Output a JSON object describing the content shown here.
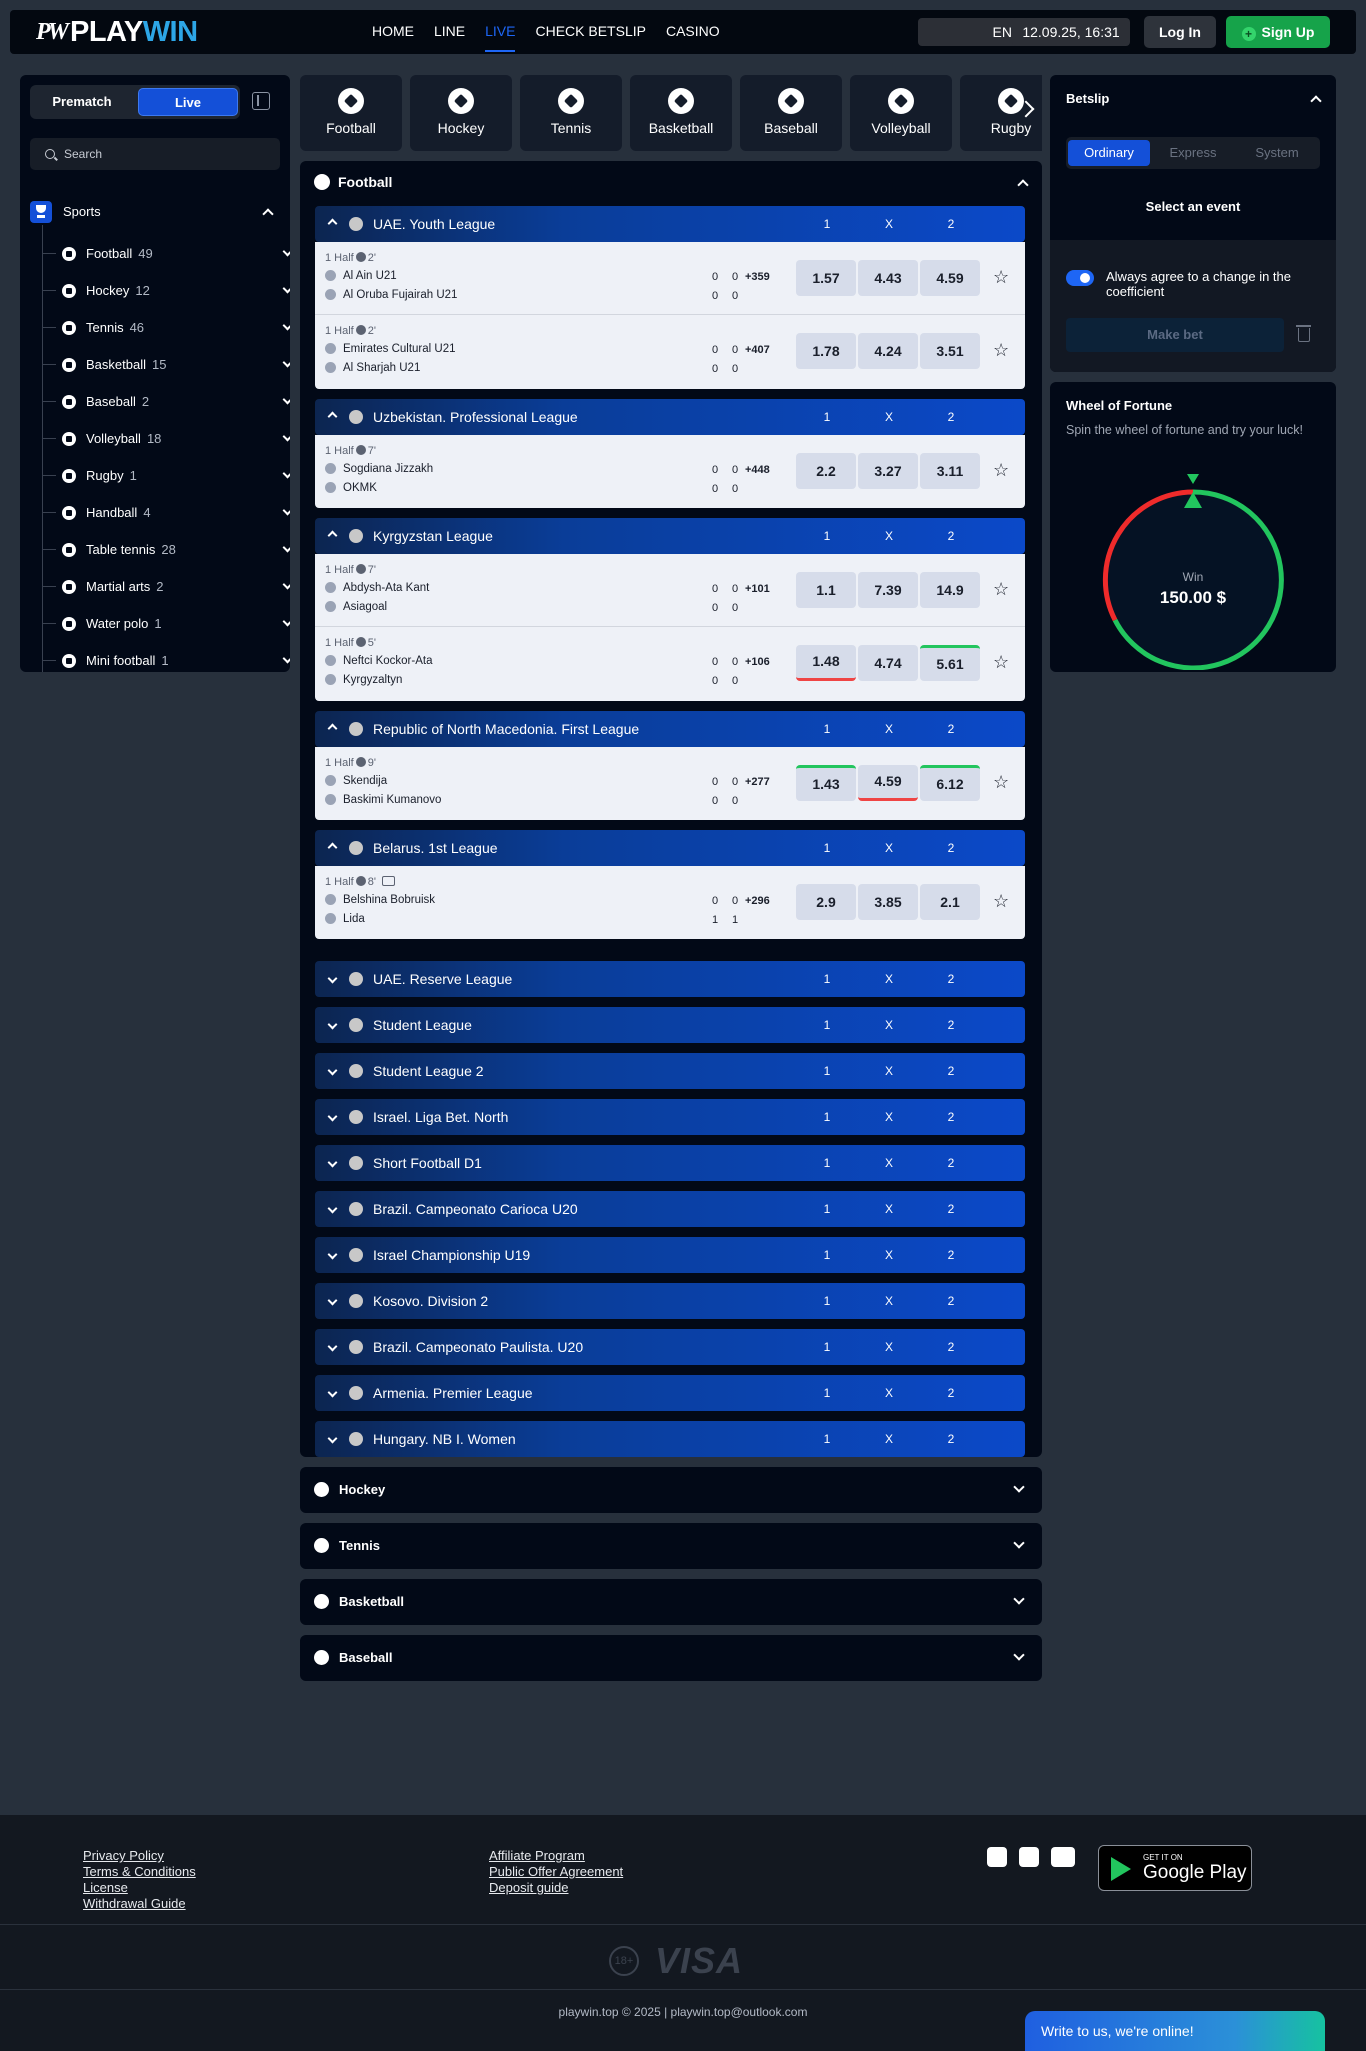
{
  "header": {
    "logo_mark": "PW",
    "logo_play": "PLAY",
    "logo_win": "WIN",
    "nav": [
      "HOME",
      "LINE",
      "LIVE",
      "CHECK BETSLIP",
      "CASINO"
    ],
    "nav_active": "LIVE",
    "lang": "EN",
    "datetime": "12.09.25, 16:31",
    "login": "Log In",
    "signup": "Sign Up",
    "signup_icon": "+"
  },
  "sidebar": {
    "prematch": "Prematch",
    "live": "Live",
    "search_placeholder": "Search",
    "sports_title": "Sports",
    "sports": [
      {
        "name": "Football",
        "count": "49"
      },
      {
        "name": "Hockey",
        "count": "12"
      },
      {
        "name": "Tennis",
        "count": "46"
      },
      {
        "name": "Basketball",
        "count": "15"
      },
      {
        "name": "Baseball",
        "count": "2"
      },
      {
        "name": "Volleyball",
        "count": "18"
      },
      {
        "name": "Rugby",
        "count": "1"
      },
      {
        "name": "Handball",
        "count": "4"
      },
      {
        "name": "Table tennis",
        "count": "28"
      },
      {
        "name": "Martial arts",
        "count": "2"
      },
      {
        "name": "Water polo",
        "count": "1"
      },
      {
        "name": "Mini football",
        "count": "1"
      }
    ]
  },
  "tabs": [
    "Football",
    "Hockey",
    "Tennis",
    "Basketball",
    "Baseball",
    "Volleyball",
    "Rugby"
  ],
  "football": {
    "title": "Football",
    "col1": "1",
    "colx": "X",
    "col2": "2",
    "leagues": [
      {
        "name": "UAE. Youth League",
        "matches": [
          {
            "period": "1 Half",
            "time": "2'",
            "t1": "Al Ain U21",
            "t2": "Al Oruba Fujairah U21",
            "s1a": "0",
            "s1b": "0",
            "s2a": "0",
            "s2b": "0",
            "more": "+359",
            "o1": "1.57",
            "ox": "4.43",
            "o2": "4.59"
          },
          {
            "period": "1 Half",
            "time": "2'",
            "t1": "Emirates Cultural U21",
            "t2": "Al Sharjah U21",
            "s1a": "0",
            "s1b": "0",
            "s2a": "0",
            "s2b": "0",
            "more": "+407",
            "o1": "1.78",
            "ox": "4.24",
            "o2": "3.51"
          }
        ]
      },
      {
        "name": "Uzbekistan. Professional League",
        "matches": [
          {
            "period": "1 Half",
            "time": "7'",
            "t1": "Sogdiana Jizzakh",
            "t2": "OKMK",
            "s1a": "0",
            "s1b": "0",
            "s2a": "0",
            "s2b": "0",
            "more": "+448",
            "o1": "2.2",
            "ox": "3.27",
            "o2": "3.11"
          }
        ]
      },
      {
        "name": "Kyrgyzstan League",
        "matches": [
          {
            "period": "1 Half",
            "time": "7'",
            "t1": "Abdysh-Ata Kant",
            "t2": "Asiagoal",
            "s1a": "0",
            "s1b": "0",
            "s2a": "0",
            "s2b": "0",
            "more": "+101",
            "o1": "1.1",
            "ox": "7.39",
            "o2": "14.9"
          },
          {
            "period": "1 Half",
            "time": "5'",
            "t1": "Neftci Kockor-Ata",
            "t2": "Kyrgyzaltyn",
            "s1a": "0",
            "s1b": "0",
            "s2a": "0",
            "s2b": "0",
            "more": "+106",
            "o1": "1.48",
            "ox": "4.74",
            "o2": "5.61"
          }
        ]
      },
      {
        "name": "Republic of North Macedonia. First League",
        "matches": [
          {
            "period": "1 Half",
            "time": "9'",
            "t1": "Skendija",
            "t2": "Baskimi Kumanovo",
            "s1a": "0",
            "s1b": "0",
            "s2a": "0",
            "s2b": "0",
            "more": "+277",
            "o1": "1.43",
            "ox": "4.59",
            "o2": "6.12"
          }
        ]
      },
      {
        "name": "Belarus. 1st League",
        "matches": [
          {
            "period": "1 Half",
            "time": "8'",
            "t1": "Belshina Bobruisk",
            "t2": "Lida",
            "s1a": "0",
            "s1b": "0",
            "s2a": "1",
            "s2b": "1",
            "more": "+296",
            "o1": "2.9",
            "ox": "3.85",
            "o2": "2.1"
          }
        ]
      }
    ],
    "collapsed": [
      "UAE. Reserve League",
      "Student League",
      "Student League 2",
      "Israel. Liga Bet. North",
      "Short Football D1",
      "Brazil. Campeonato Carioca U20",
      "Israel Championship U19",
      "Kosovo. Division 2",
      "Brazil. Campeonato Paulista. U20",
      "Armenia. Premier League",
      "Hungary. NB I. Women"
    ]
  },
  "other_sports": [
    "Hockey",
    "Tennis",
    "Basketball",
    "Baseball"
  ],
  "betslip": {
    "title": "Betslip",
    "types": [
      "Ordinary",
      "Express",
      "System"
    ],
    "select_event": "Select an event",
    "agree": "Always agree to a change in the coefficient",
    "make_bet": "Make bet"
  },
  "wheel": {
    "title": "Wheel of Fortune",
    "subtitle": "Spin the wheel of fortune and try your luck!",
    "win_label": "Win",
    "amount": "150.00 $"
  },
  "footer": {
    "links_left": [
      "Privacy Policy",
      "Terms & Conditions",
      "License",
      "Withdrawal Guide"
    ],
    "links_mid": [
      "Affiliate Program",
      "Public Offer Agreement",
      "Deposit guide"
    ],
    "gp_small": "GET IT ON",
    "gp_big": "Google Play",
    "age": "18+",
    "visa": "VISA",
    "copyright": "playwin.top © 2025 | playwin.top@outlook.com"
  },
  "chat": "Write to us, we're online!",
  "colors": {
    "accent": "#1e66f5",
    "brand": "#2da6e6",
    "signup": "#16a34a",
    "odds_up": "#22c55e",
    "odds_down": "#ef4444"
  }
}
